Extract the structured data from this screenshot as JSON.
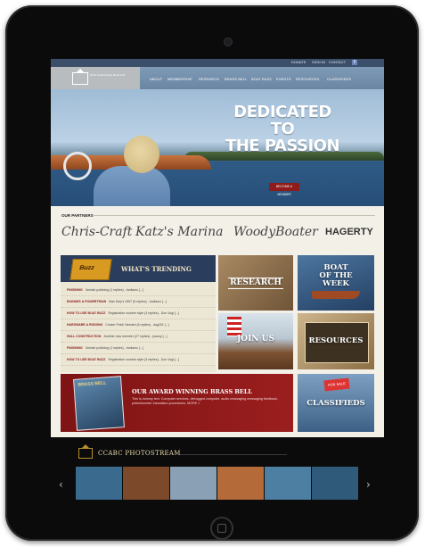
{
  "topbar": {
    "links": [
      "DONATE",
      "SIGN IN",
      "CONTACT"
    ],
    "facebook": "f"
  },
  "logo": {
    "text": "Chris-Craft Antique Boat Club"
  },
  "nav": [
    "ABOUT",
    "MEMBERSHIP",
    "RESEARCH",
    "BRASS BELL",
    "BOAT BUZZ",
    "EVENTS",
    "RESOURCES",
    "CLASSIFIEDS"
  ],
  "hero": {
    "headline_1": "DEDICATED TO",
    "headline_2": "THE PASSION",
    "cta": "BECOME A MEMBER"
  },
  "partners": {
    "label": "OUR PARTNERS",
    "items": [
      "Chris-Craft",
      "Katz's Marina",
      "WoodyBoater",
      "HAGERTY"
    ]
  },
  "trending": {
    "badge": "Buzz",
    "title": "WHAT'S TRENDING",
    "rows": [
      {
        "category": "FINISHING",
        "text": "Varnish polishing (1 replies) - bcdiamo [...]"
      },
      {
        "category": "ENGINES & POWERTRAIN",
        "text": "Max Doty's 1957 (6 replies) - bcdiamo [...]"
      },
      {
        "category": "HOW TO USE BOAT BUZZ",
        "text": "Registration number style (3 replies) - Don Vogt [...]"
      },
      {
        "category": "HARDWARE & RIGGING",
        "text": "Cruiser Fetch Needed (6 replies) - dag201 [...]"
      },
      {
        "category": "HULL CONSTRUCTION",
        "text": "Another new member (27 replies) - jsanny [...]"
      },
      {
        "category": "FINISHING",
        "text": "Varnish polishing (1 replies) - bcdiamo [...]"
      },
      {
        "category": "HOW TO USE BOAT BUZZ",
        "text": "Registration number style (3 replies) - Don Vogt [...]"
      }
    ]
  },
  "tiles": {
    "research": "RESEARCH",
    "boat_of_week_1": "BOAT",
    "boat_of_week_2": "OF THE",
    "boat_of_week_3": "WEEK",
    "join": "JOIN US",
    "resources": "RESOURCES",
    "classifieds": "CLASSIFIEDS",
    "classifieds_sign": "FOR SALE"
  },
  "award": {
    "magazine": "BRASS BELL",
    "title": "OUR AWARD WINNING BRASS BELL",
    "desc": "This is dummy text. Computer services, debugged computer, audio messaging messaging feedback, potentiometer translation procedures.",
    "more": "MORE »"
  },
  "stream": {
    "title": "CCABC PHOTOSTREAM",
    "prev": "‹",
    "next": "›"
  },
  "colors": {
    "thumb1": "#3a6b8f",
    "thumb2": "#7c4a2a",
    "thumb3": "#8aa0b4",
    "thumb4": "#b56a3a",
    "thumb5": "#4d7fa3",
    "thumb6": "#2f5a7a"
  }
}
